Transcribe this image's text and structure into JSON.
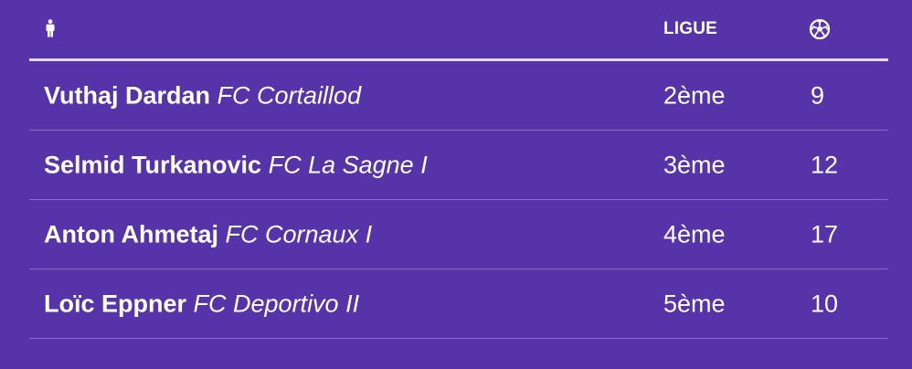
{
  "header": {
    "player_icon": "person-icon",
    "league_label": "LIGUE",
    "goals_icon": "soccer-ball-icon"
  },
  "rows": [
    {
      "name": "Vuthaj Dardan",
      "club": "FC Cortaillod",
      "league": "2ème",
      "goals": "9"
    },
    {
      "name": "Selmid Turkanovic",
      "club": "FC La Sagne I",
      "league": "3ème",
      "goals": "12"
    },
    {
      "name": "Anton Ahmetaj",
      "club": "FC Cornaux I",
      "league": "4ème",
      "goals": "17"
    },
    {
      "name": "Loïc Eppner",
      "club": "FC Deportivo II",
      "league": "5ème",
      "goals": "10"
    }
  ],
  "colors": {
    "background": "#5733aa",
    "text": "#ffffff",
    "header_rule": "#e3dcef"
  }
}
